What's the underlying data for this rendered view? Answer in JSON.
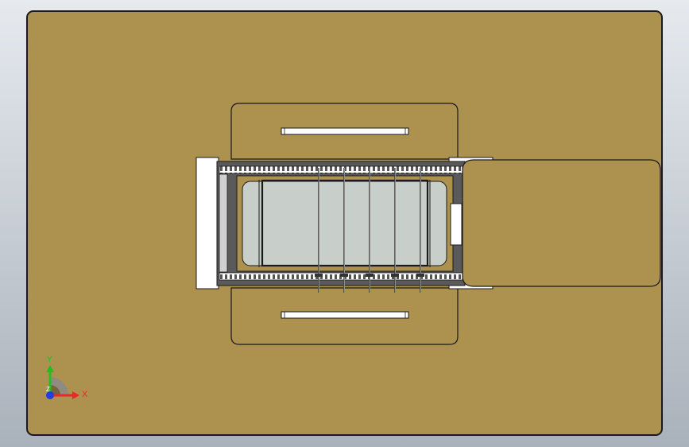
{
  "viewport": {
    "background_top": "#e6eaef",
    "background_bottom": "#a9b1ba"
  },
  "model": {
    "base_plate_color": "#ad914f",
    "edge_color": "#1a1a1a",
    "white_face_color": "#ffffff",
    "window_color": "#c8cfca",
    "rail_color": "#5a5a5a",
    "rod_count": 5
  },
  "triad": {
    "x_label": "X",
    "y_label": "Y",
    "z_label": "Z",
    "x_color": "#e8282a",
    "y_color": "#20c020",
    "z_color": "#1f3fe0"
  }
}
